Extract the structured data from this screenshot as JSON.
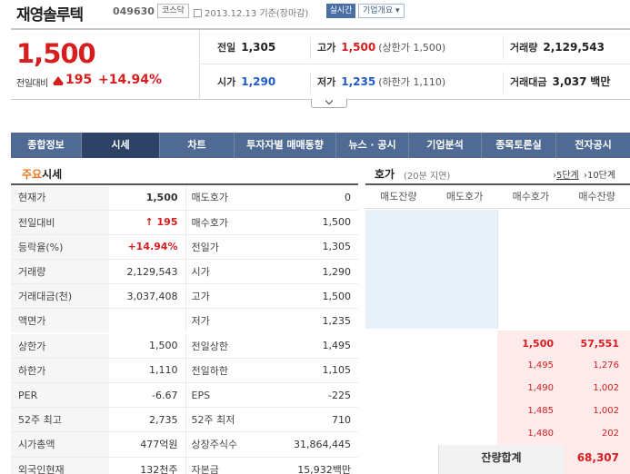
{
  "header": {
    "company": "재영솔루텍",
    "code": "049630",
    "market": "코스닥",
    "date": "2013.12.13",
    "date_suffix": "기준(장마감)",
    "realtime_label": "실시간",
    "company_info_label": "기업개요"
  },
  "price": {
    "current": "1,500",
    "prev_label": "전일대비",
    "change": "195",
    "change_pct": "+14.94%",
    "color_up": "#d61e1e",
    "color_down": "#1e5ac8"
  },
  "summary": {
    "prev_close_label": "전일",
    "prev_close": "1,305",
    "high_label": "고가",
    "high": "1,500",
    "high_note": "(상한가 1,500)",
    "volume_label": "거래량",
    "volume": "2,129,543",
    "open_label": "시가",
    "open": "1,290",
    "low_label": "저가",
    "low": "1,235",
    "low_note": "(하한가 1,110)",
    "amount_label": "거래대금",
    "amount": "3,037",
    "amount_unit": "백만"
  },
  "nav": {
    "tabs": [
      "종합정보",
      "시세",
      "차트",
      "투자자별 매매동향",
      "뉴스 · 공시",
      "기업분석",
      "종목토론실",
      "전자공시"
    ],
    "active": "시세"
  },
  "stats": {
    "title_hl": "주요",
    "title_rest": "시세",
    "rows": [
      {
        "k1": "현재가",
        "v1": "1,500",
        "k2": "매도호가",
        "v2": "0"
      },
      {
        "k1": "전일대비",
        "v1": "195",
        "k2": "매수호가",
        "v2": "1,500"
      },
      {
        "k1": "등락율(%)",
        "v1": "+14.94%",
        "k2": "전일가",
        "v2": "1,305"
      },
      {
        "k1": "거래량",
        "v1": "2,129,543",
        "k2": "시가",
        "v2": "1,290"
      },
      {
        "k1": "거래대금(천)",
        "v1": "3,037,408",
        "k2": "고가",
        "v2": "1,500"
      },
      {
        "k1": "액면가",
        "v1": "",
        "k2": "저가",
        "v2": "1,235"
      },
      {
        "k1": "상한가",
        "v1": "1,500",
        "k2": "전일상한",
        "v2": "1,495"
      },
      {
        "k1": "하한가",
        "v1": "1,110",
        "k2": "전일하한",
        "v2": "1,105"
      },
      {
        "k1": "PER",
        "v1": "-6.67",
        "k2": "EPS",
        "v2": "-225"
      },
      {
        "k1": "52주 최고",
        "v1": "2,735",
        "k2": "52주 최저",
        "v2": "710"
      },
      {
        "k1": "시가총액",
        "v1": "477억원",
        "k2": "상장주식수",
        "v2": "31,864,445"
      },
      {
        "k1": "외국인현재",
        "v1": "132천주",
        "k2": "자본금",
        "v2": "15,932백만"
      }
    ]
  },
  "orderbook": {
    "title": "호가",
    "delay": "(20분 지연)",
    "link5": "5단계",
    "link10": "10단계",
    "headers": [
      "매도잔량",
      "매도호가",
      "매수호가",
      "매수잔량"
    ],
    "bids": [
      {
        "price": "1,500",
        "qty": "57,551"
      },
      {
        "price": "1,495",
        "qty": "1,276"
      },
      {
        "price": "1,490",
        "qty": "1,002"
      },
      {
        "price": "1,485",
        "qty": "1,002"
      },
      {
        "price": "1,480",
        "qty": "202"
      }
    ],
    "total_label": "잔량합계",
    "total_bid": "68,307"
  }
}
